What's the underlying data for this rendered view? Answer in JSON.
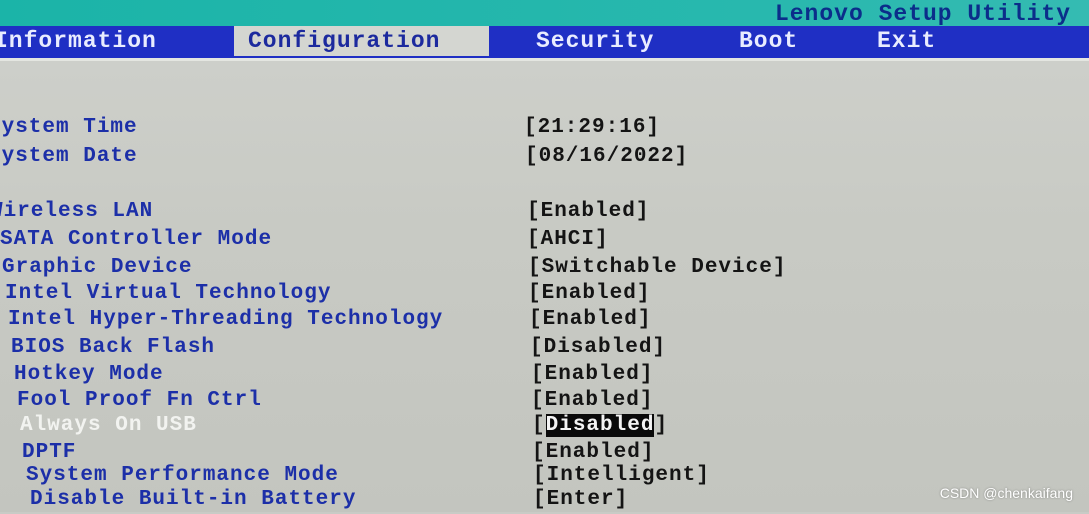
{
  "app": {
    "title": "Lenovo Setup Utility"
  },
  "menu": {
    "tabs": [
      {
        "label": "Information"
      },
      {
        "label": "Configuration"
      },
      {
        "label": "Security"
      },
      {
        "label": "Boot"
      },
      {
        "label": "Exit"
      }
    ],
    "active_tab": "Configuration"
  },
  "settings": [
    {
      "label": "System Time",
      "value": "[21:29:16]"
    },
    {
      "label": "System Date",
      "value": "[08/16/2022]"
    },
    {
      "label": "Wireless LAN",
      "value": "[Enabled]"
    },
    {
      "label": "SATA Controller Mode",
      "value": "[AHCI]"
    },
    {
      "label": "Graphic Device",
      "value": "[Switchable Device]"
    },
    {
      "label": "Intel Virtual Technology",
      "value": "[Enabled]"
    },
    {
      "label": "Intel Hyper-Threading Technology",
      "value": "[Enabled]"
    },
    {
      "label": "BIOS Back Flash",
      "value": "[Disabled]"
    },
    {
      "label": "Hotkey Mode",
      "value": "[Enabled]"
    },
    {
      "label": "Fool Proof Fn Ctrl",
      "value": "[Enabled]"
    },
    {
      "label": "Always On USB",
      "value_open": "[",
      "value_text": "Disabled",
      "value_close": "]",
      "selected": true
    },
    {
      "label": "DPTF",
      "value": "[Enabled]"
    },
    {
      "label": "System Performance Mode",
      "value": "[Intelligent]"
    },
    {
      "label": "Disable Built-in Battery",
      "value": "[Enter]"
    }
  ],
  "watermark": "CSDN @chenkaifang",
  "colors": {
    "title_strip": "#1bb4a8",
    "menubar": "#1f2fc4",
    "label_text": "#1c2fa8",
    "value_text": "#141414",
    "selected_label": "#f2f3f0",
    "selected_value_bg": "#0a0a0a"
  }
}
